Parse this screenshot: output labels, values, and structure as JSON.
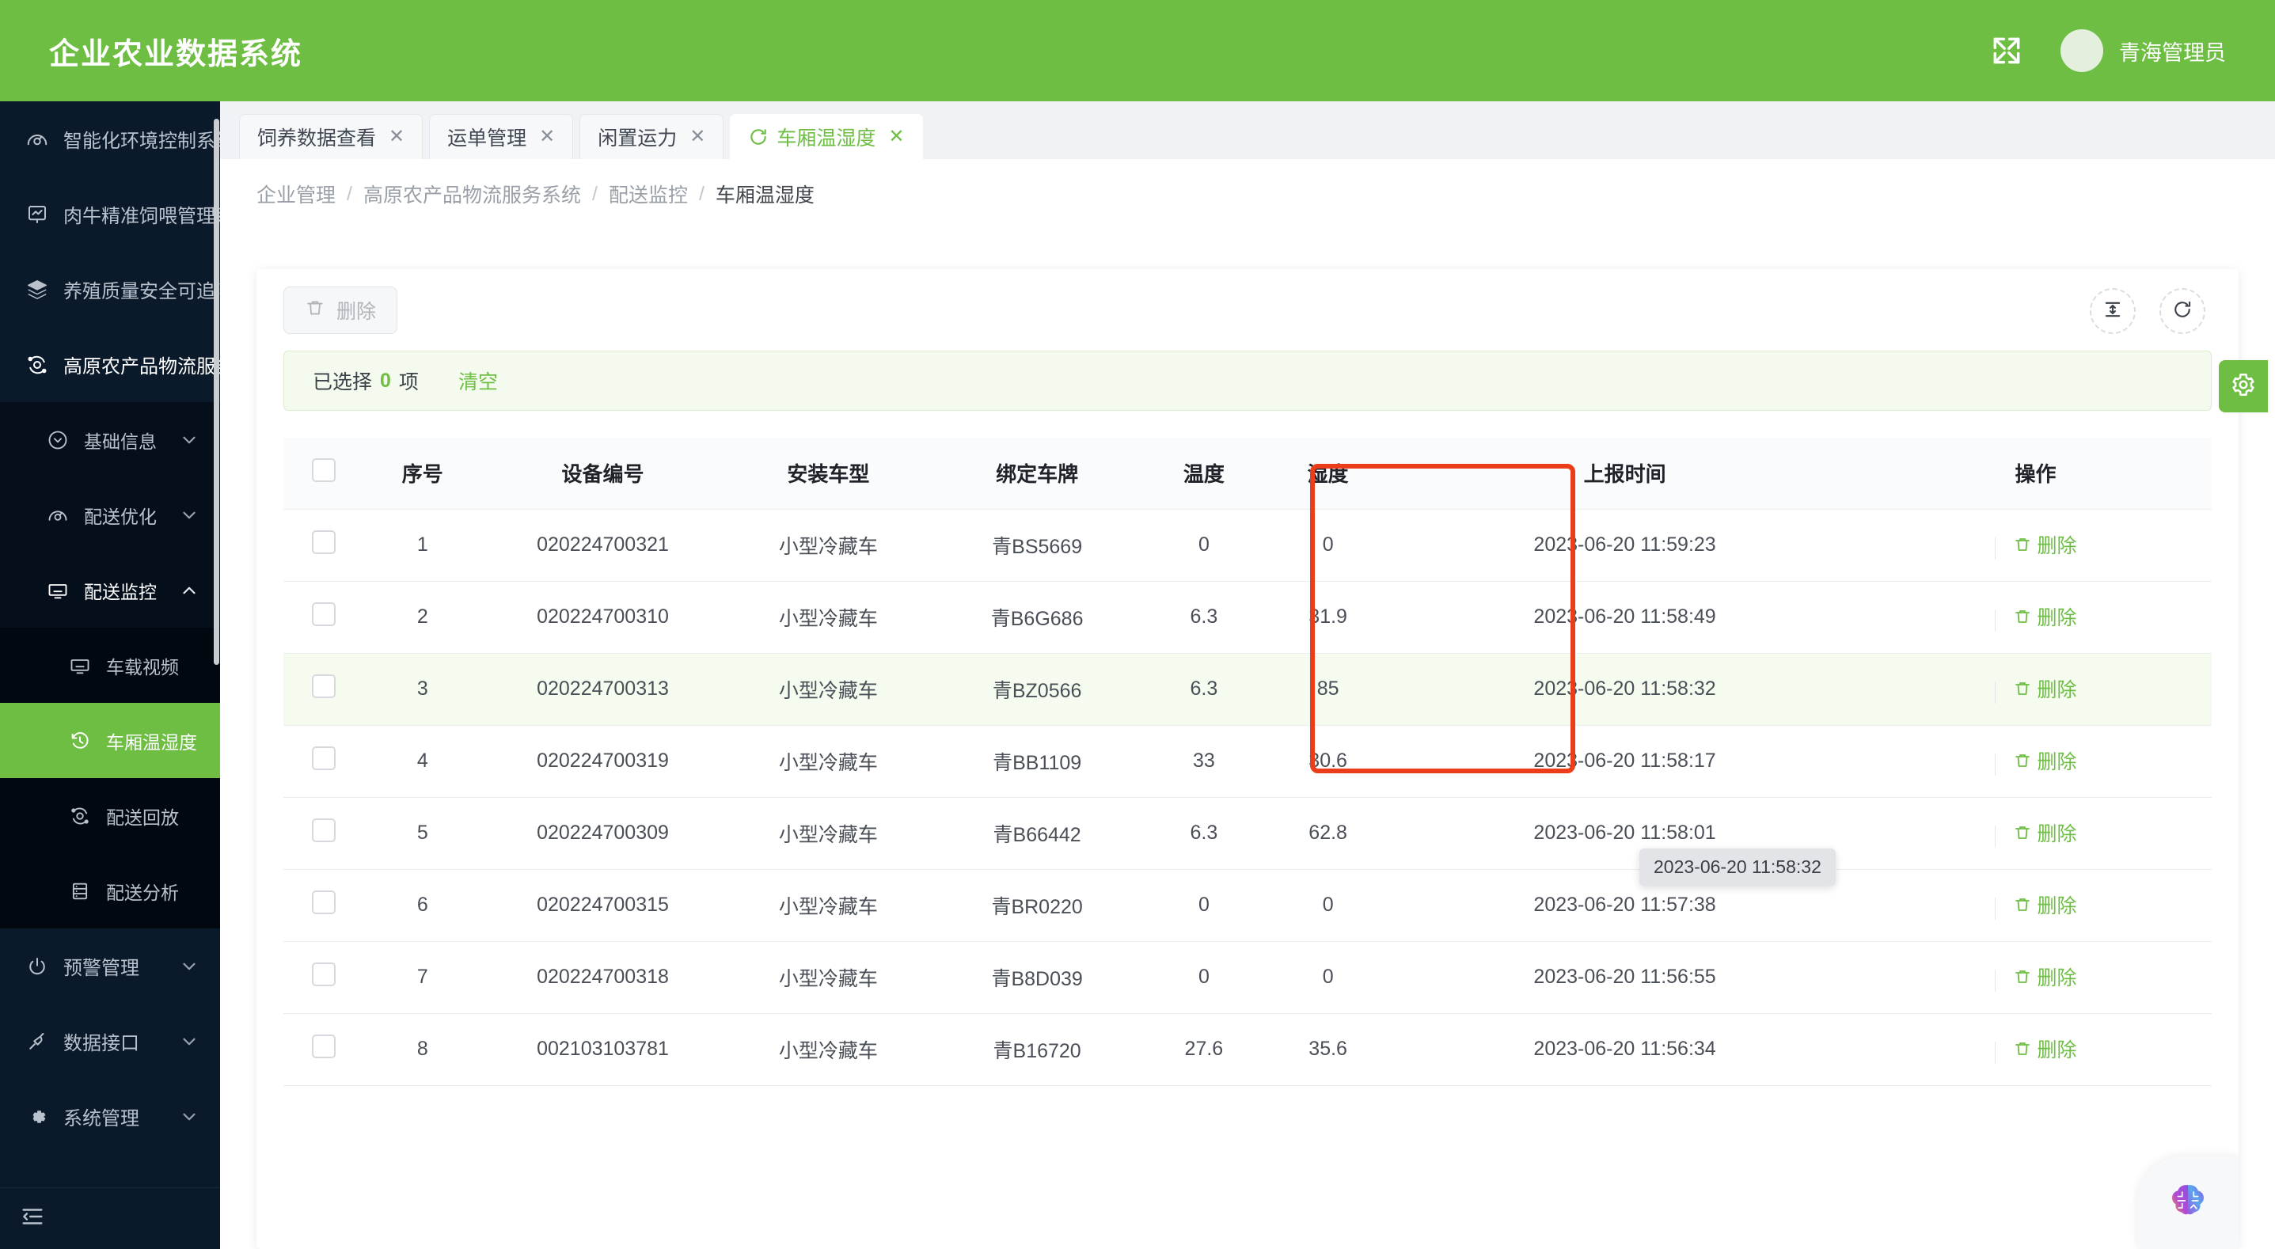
{
  "header": {
    "brand": "企业农业数据系统",
    "fullscreen_icon": "fullscreen-expand-icon",
    "username": "青海管理员"
  },
  "sidebar": {
    "items": [
      {
        "label": "智能化环境控制系统",
        "icon": "gauge-icon",
        "expanded": false
      },
      {
        "label": "肉牛精准饲喂管理系统",
        "icon": "chart-monitor-icon",
        "expanded": false
      },
      {
        "label": "养殖质量安全可追溯系统",
        "icon": "layers-icon",
        "expanded": false
      },
      {
        "label": "高原农产品物流服务系统",
        "icon": "orbit-icon",
        "expanded": true
      }
    ],
    "sub_items": [
      {
        "label": "基础信息",
        "icon": "circle-chevron-icon"
      },
      {
        "label": "配送优化",
        "icon": "gauge-icon"
      },
      {
        "label": "配送监控",
        "icon": "monitor-icon",
        "expanded": true
      }
    ],
    "sub_sub_items": [
      {
        "label": "车载视频",
        "icon": "monitor-icon",
        "active": false
      },
      {
        "label": "车厢温湿度",
        "icon": "history-clock-icon",
        "active": true
      },
      {
        "label": "配送回放",
        "icon": "orbit-icon",
        "active": false
      },
      {
        "label": "配送分析",
        "icon": "server-rack-icon",
        "active": false
      }
    ],
    "tail_items": [
      {
        "label": "预警管理",
        "icon": "power-icon"
      },
      {
        "label": "数据接口",
        "icon": "plug-icon"
      },
      {
        "label": "系统管理",
        "icon": "gear-icon"
      }
    ],
    "collapse_icon": "collapse-menu-icon"
  },
  "tabs": [
    {
      "label": "饲养数据查看",
      "active": false,
      "close": "✕"
    },
    {
      "label": "运单管理",
      "active": false,
      "close": "✕"
    },
    {
      "label": "闲置运力",
      "active": false,
      "close": "✕"
    },
    {
      "label": "车厢温湿度",
      "active": true,
      "close": "✕",
      "icon": "refresh-spin-icon"
    }
  ],
  "breadcrumb": [
    "企业管理",
    "高原农产品物流服务系统",
    "配送监控",
    "车厢温湿度"
  ],
  "toolbar": {
    "delete_label": "删除",
    "delete_icon": "trash-icon",
    "density_icon": "row-height-icon",
    "refresh_icon": "refresh-icon",
    "settings_icon": "gear-icon"
  },
  "selection_alert": {
    "prefix": "已选择",
    "count": "0",
    "suffix": "项",
    "clear_label": "清空"
  },
  "table": {
    "columns": [
      "序号",
      "设备编号",
      "安装车型",
      "绑定车牌",
      "温度",
      "湿度",
      "上报时间",
      "操作"
    ],
    "row_action_label": "删除",
    "rows": [
      {
        "idx": "1",
        "device": "020224700321",
        "vehicle_type": "小型冷藏车",
        "plate": "青BS5669",
        "temp": "0",
        "hum": "0",
        "time": "2023-06-20 11:59:23",
        "highlight": false
      },
      {
        "idx": "2",
        "device": "020224700310",
        "vehicle_type": "小型冷藏车",
        "plate": "青B6G686",
        "temp": "6.3",
        "hum": "31.9",
        "time": "2023-06-20 11:58:49",
        "highlight": false
      },
      {
        "idx": "3",
        "device": "020224700313",
        "vehicle_type": "小型冷藏车",
        "plate": "青BZ0566",
        "temp": "6.3",
        "hum": "85",
        "time": "2023-06-20 11:58:32",
        "highlight": true
      },
      {
        "idx": "4",
        "device": "020224700319",
        "vehicle_type": "小型冷藏车",
        "plate": "青BB1109",
        "temp": "33",
        "hum": "30.6",
        "time": "2023-06-20 11:58:17",
        "highlight": false
      },
      {
        "idx": "5",
        "device": "020224700309",
        "vehicle_type": "小型冷藏车",
        "plate": "青B66442",
        "temp": "6.3",
        "hum": "62.8",
        "time": "2023-06-20 11:58:01",
        "highlight": false
      },
      {
        "idx": "6",
        "device": "020224700315",
        "vehicle_type": "小型冷藏车",
        "plate": "青BR0220",
        "temp": "0",
        "hum": "0",
        "time": "2023-06-20 11:57:38",
        "highlight": false
      },
      {
        "idx": "7",
        "device": "020224700318",
        "vehicle_type": "小型冷藏车",
        "plate": "青B8D039",
        "temp": "0",
        "hum": "0",
        "time": "2023-06-20 11:56:55",
        "highlight": false
      },
      {
        "idx": "8",
        "device": "002103103781",
        "vehicle_type": "小型冷藏车",
        "plate": "青B16720",
        "temp": "27.6",
        "hum": "35.6",
        "time": "2023-06-20 11:56:34",
        "highlight": false
      }
    ]
  },
  "tooltip": {
    "text": "2023-06-20 11:58:32"
  },
  "ai_widget": {
    "icon": "brain-ai-icon"
  },
  "annotation": {
    "color": "#ec3d1a",
    "target_columns": "温度 / 湿度"
  },
  "colors": {
    "brand_green": "#6ebe44",
    "sidebar_dark": "#0b1a2b",
    "annotation_red": "#ec3d1a"
  }
}
